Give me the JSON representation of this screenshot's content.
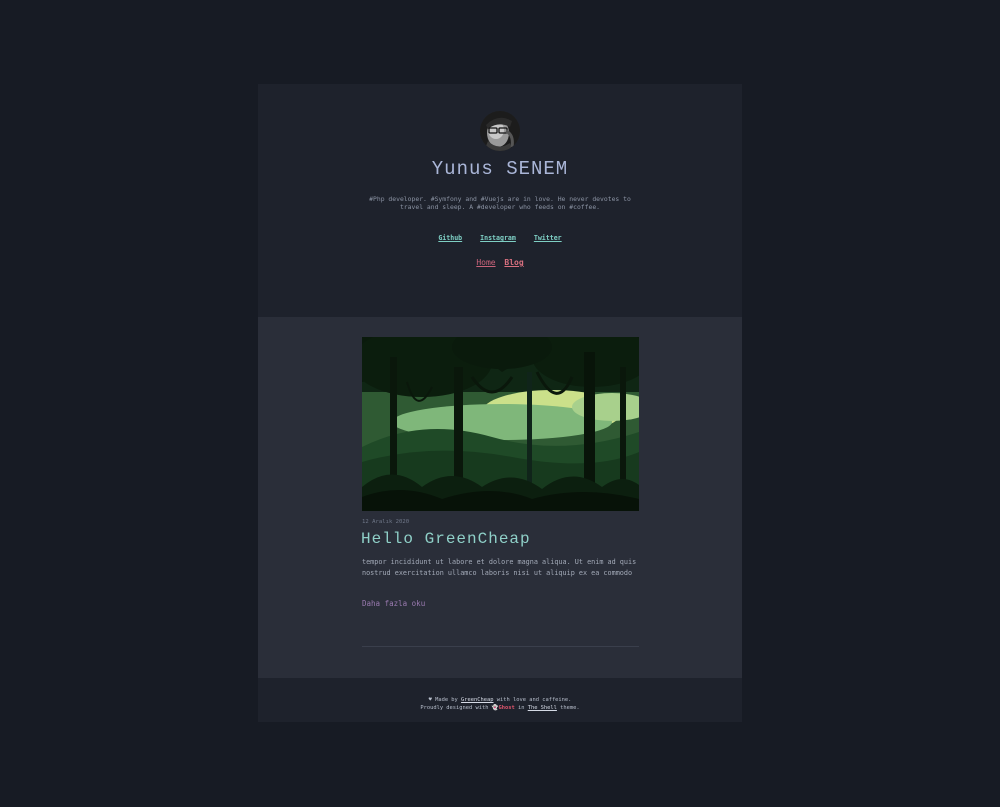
{
  "site": {
    "title": "Yunus SENEM",
    "bio": "#Php developer. #Symfony and #Vuejs are in love. He never devotes to travel and sleep. A #developer who feeds on #coffee."
  },
  "social": {
    "github": "Github",
    "instagram": "Instagram",
    "twitter": "Twitter"
  },
  "nav": {
    "home": "Home",
    "blog": "Blog"
  },
  "post": {
    "date": "12 Aralık 2020",
    "title": "Hello GreenCheap",
    "excerpt": "tempor incididunt ut labore et dolore magna aliqua. Ut enim ad quis nostrud exercitation ullamco laboris nisi ut aliquip ex ea commodo",
    "read_more": "Daha fazla oku"
  },
  "footer": {
    "heart": "♥",
    "made_by": "Made by",
    "greencheap": "GreenCheap",
    "with_love": "with love and caffeine.",
    "designed_with": "Proudly designed with",
    "ghost": "Ghost",
    "in": "in",
    "the_shell": "The Shell",
    "theme": "theme."
  },
  "colors": {
    "page_bg": "#171b24",
    "card_bg": "#1e222c",
    "main_bg": "#2a2e39",
    "accent_teal": "#8fd0c8",
    "accent_pink": "#c9637a"
  }
}
